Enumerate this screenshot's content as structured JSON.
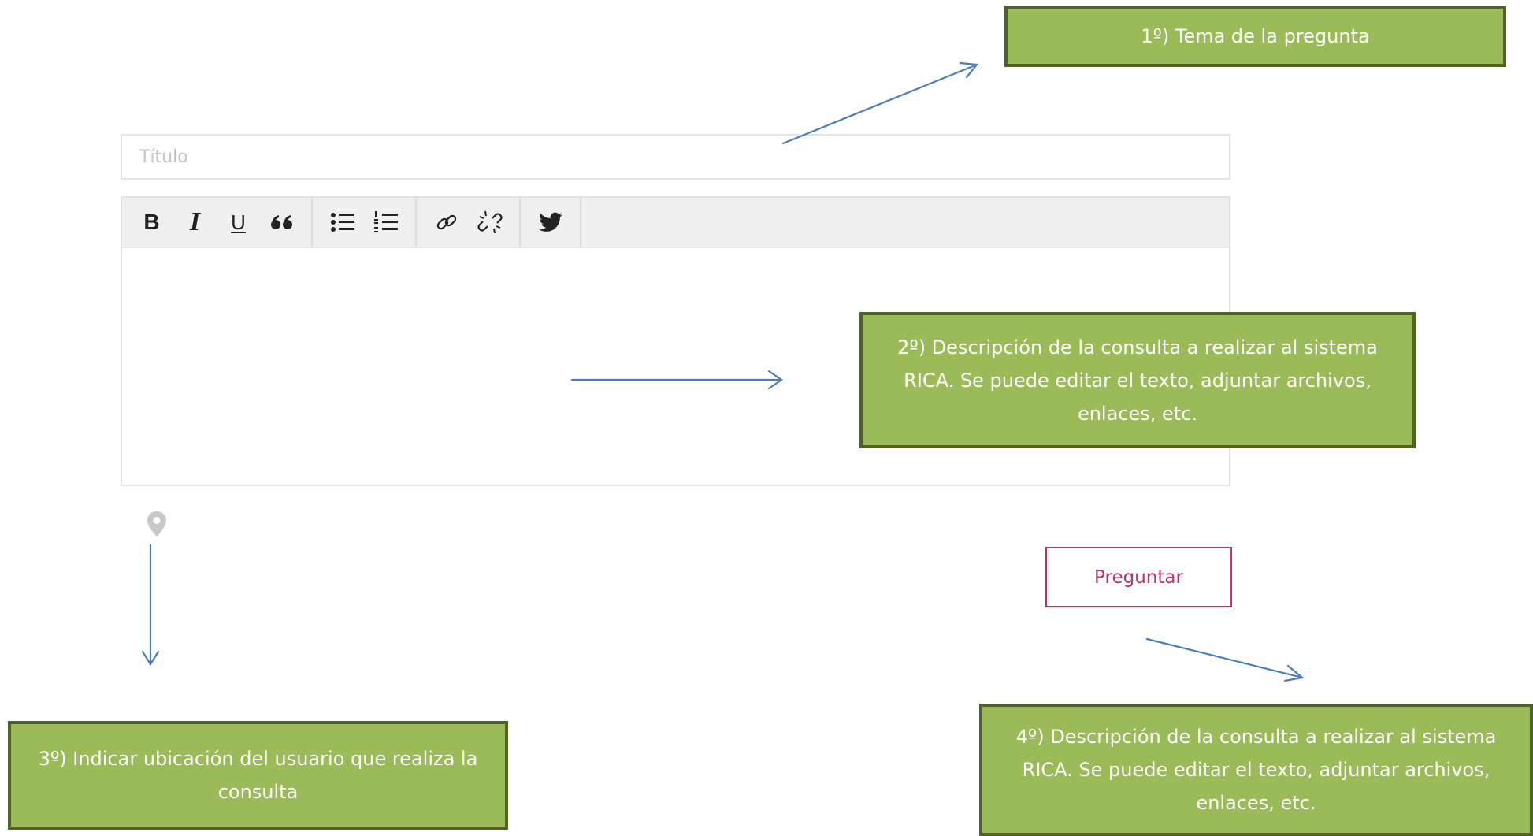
{
  "form": {
    "title_placeholder": "Título",
    "submit_label": "Preguntar",
    "toolbar": [
      "bold",
      "italic",
      "underline",
      "blockquote",
      "bulleted-list",
      "numbered-list",
      "link",
      "unlink",
      "twitter"
    ]
  },
  "annotations": {
    "step1": "1º) Tema de la pregunta",
    "step2": "2º) Descripción de la consulta a realizar al sistema RICA. Se puede editar el texto, adjuntar archivos, enlaces, etc.",
    "step3": "3º) Indicar ubicación del usuario que realiza la consulta",
    "step4": "4º) Descripción de la consulta a realizar al sistema RICA. Se puede editar el texto, adjuntar archivos, enlaces, etc."
  },
  "colors": {
    "callout_fill": "#9bbb59",
    "callout_border": "#4f6228",
    "arrow": "#4a7ebb",
    "button_accent": "#b8336a"
  }
}
